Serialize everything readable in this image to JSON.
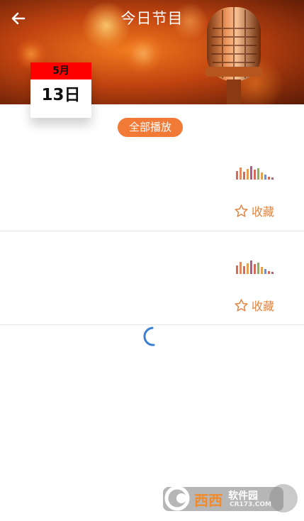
{
  "header": {
    "title": "今日节目",
    "back_icon": "arrow-left-icon"
  },
  "calendar": {
    "month": "5月",
    "day": "13日"
  },
  "actions": {
    "play_all_label": "全部播放"
  },
  "programs": [
    {
      "favorite_label": "收藏",
      "favorite_icon": "star-outline-icon",
      "audio_icon": "audio-bars-icon"
    },
    {
      "favorite_label": "收藏",
      "favorite_icon": "star-outline-icon",
      "audio_icon": "audio-bars-icon"
    }
  ],
  "loading": {
    "icon": "loading-spinner-icon"
  },
  "watermark": {
    "brand": "西西",
    "product": "软件园",
    "domain": "CR173.COM"
  },
  "colors": {
    "accent": "#f07a36",
    "favorite_text": "#e2833f",
    "calendar_month_bg": "#ff0000",
    "spinner": "#3b7fd4",
    "divider": "#e6e6e6"
  }
}
